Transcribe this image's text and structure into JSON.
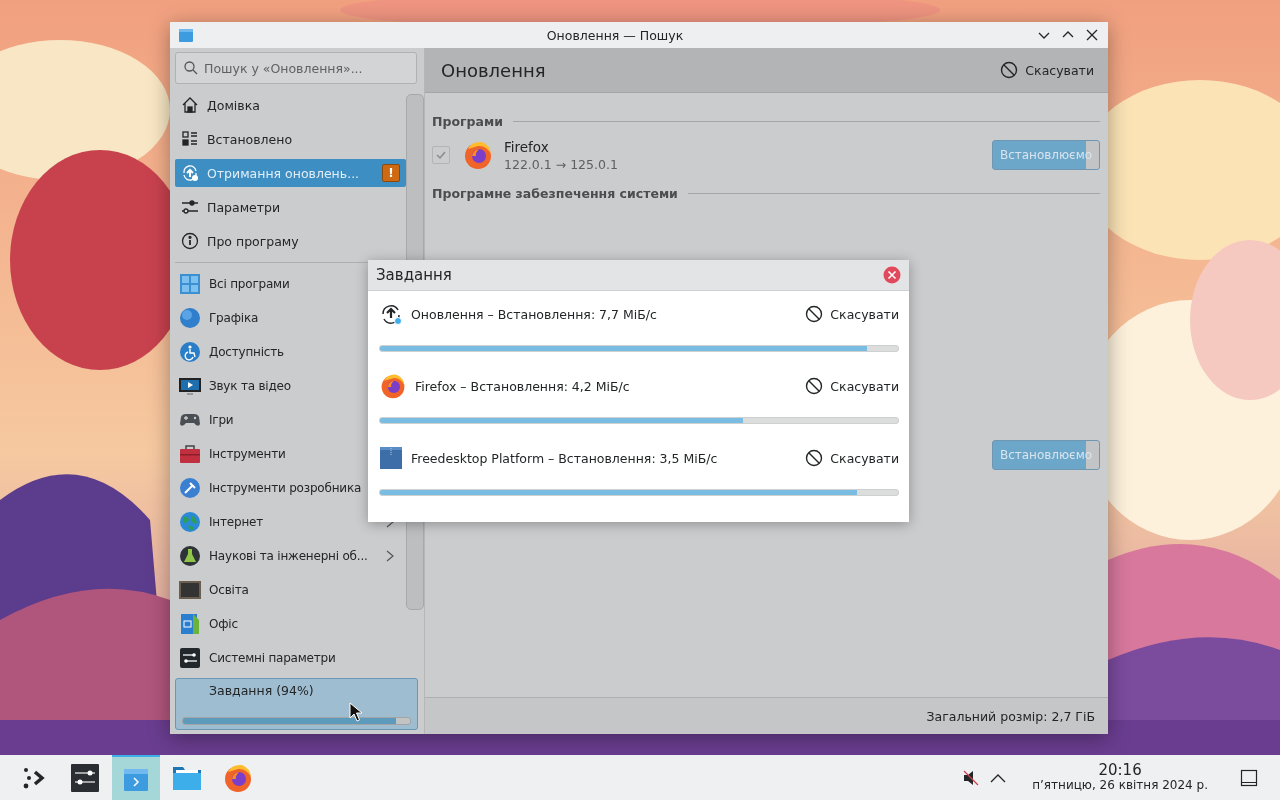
{
  "window": {
    "title": "Оновлення — Пошук"
  },
  "search": {
    "placeholder": "Пошук у «Оновлення»..."
  },
  "nav": [
    {
      "label": "Домівка",
      "kind": "home",
      "selected": false
    },
    {
      "label": "Встановлено",
      "kind": "installed",
      "selected": false
    },
    {
      "label": "Отримання оновлень...",
      "kind": "updates",
      "selected": true,
      "badge": "!"
    },
    {
      "label": "Параметри",
      "kind": "settings",
      "selected": false
    },
    {
      "label": "Про програму",
      "kind": "about",
      "selected": false
    }
  ],
  "categories": [
    {
      "label": "Всі програми",
      "kind": "grid"
    },
    {
      "label": "Графіка",
      "kind": "sphere"
    },
    {
      "label": "Доступність",
      "kind": "access"
    },
    {
      "label": "Звук та відео",
      "kind": "monitor"
    },
    {
      "label": "Ігри",
      "kind": "gamepad"
    },
    {
      "label": "Інструменти",
      "kind": "toolbox"
    },
    {
      "label": "Інструменти розробника",
      "kind": "hammer"
    },
    {
      "label": "Інтернет",
      "kind": "globe",
      "submenu": true
    },
    {
      "label": "Наукові та інженерні об...",
      "kind": "flask",
      "submenu": true
    },
    {
      "label": "Освіта",
      "kind": "board",
      "submenu": false
    },
    {
      "label": "Офіс",
      "kind": "office",
      "submenu": false
    },
    {
      "label": "Системні параметри",
      "kind": "syssettings",
      "submenu": false
    }
  ],
  "tasks_footer": {
    "label": "Завдання (94%)",
    "level": 0.94
  },
  "header": {
    "title": "Оновлення",
    "cancel": "Скасувати"
  },
  "sections": [
    {
      "title": "Програми",
      "rows": [
        {
          "kind": "firefox",
          "name": "Firefox",
          "version": "122.0.1 → 125.0.1",
          "checked": true,
          "button": "Встановлюємо"
        }
      ]
    },
    {
      "title": "Програмне забезпечення системи",
      "rows": [
        {
          "kind": "hidden",
          "button": "Встановлюємо"
        }
      ]
    }
  ],
  "status_bar": {
    "total": "Загальний розмір: 2,7 ГіБ"
  },
  "dialog": {
    "title": "Завдання",
    "tasks": [
      {
        "kind": "update",
        "label": "Оновлення – Встановлення: 7,7 МіБ/с",
        "cancel": "Скасувати",
        "level": 0.94
      },
      {
        "kind": "firefox",
        "label": "Firefox – Встановлення: 4,2 МіБ/с",
        "cancel": "Скасувати",
        "level": 0.7
      },
      {
        "kind": "package",
        "label": "Freedesktop Platform – Встановлення: 3,5 МіБ/с",
        "cancel": "Скасувати",
        "level": 0.92
      }
    ]
  },
  "taskbar": {
    "apps": [
      {
        "kind": "launcher",
        "selected": false
      },
      {
        "kind": "settings",
        "selected": false
      },
      {
        "kind": "discover",
        "selected": true
      },
      {
        "kind": "files",
        "selected": false
      },
      {
        "kind": "firefox",
        "selected": false
      }
    ],
    "clock": {
      "time": "20:16",
      "date": "п’ятницю, 26 квітня 2024 р."
    }
  }
}
